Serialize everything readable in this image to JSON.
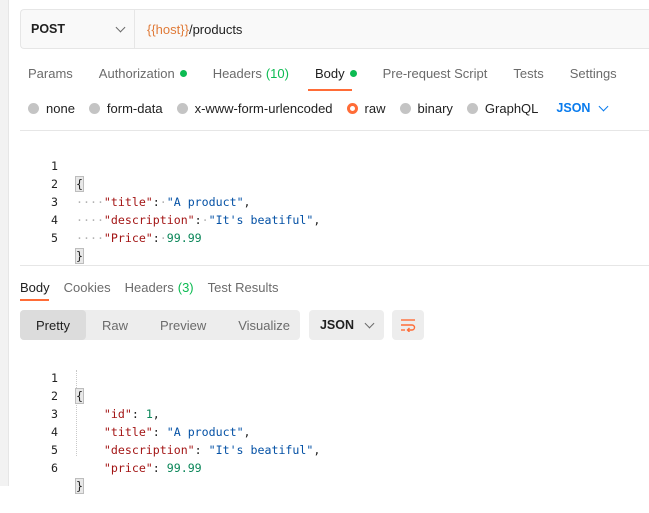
{
  "request": {
    "method": "POST",
    "url_var": "{{host}}",
    "url_path": "/products"
  },
  "request_tabs": [
    {
      "label": "Params"
    },
    {
      "label": "Authorization",
      "dot": true
    },
    {
      "label": "Headers",
      "count": "(10)"
    },
    {
      "label": "Body",
      "dot": true,
      "active": true
    },
    {
      "label": "Pre-request Script"
    },
    {
      "label": "Tests"
    },
    {
      "label": "Settings"
    }
  ],
  "body_types": {
    "options": [
      "none",
      "form-data",
      "x-www-form-urlencoded",
      "raw",
      "binary",
      "GraphQL"
    ],
    "selected": "raw",
    "format": "JSON"
  },
  "request_body": {
    "line_numbers": [
      "1",
      "2",
      "3",
      "4",
      "5"
    ],
    "open_brace": "{",
    "close_brace": "}",
    "fields": [
      {
        "key": "\"title\"",
        "value": "\"A product\"",
        "type": "str",
        "comma": ","
      },
      {
        "key": "\"description\"",
        "value": "\"It's beatiful\"",
        "type": "str",
        "comma": ","
      },
      {
        "key": "\"Price\"",
        "value": "99.99",
        "type": "num",
        "comma": ""
      }
    ]
  },
  "response_tabs": [
    {
      "label": "Body",
      "active": true
    },
    {
      "label": "Cookies"
    },
    {
      "label": "Headers",
      "count": "(3)"
    },
    {
      "label": "Test Results"
    }
  ],
  "response_view": {
    "modes": [
      "Pretty",
      "Raw",
      "Preview",
      "Visualize"
    ],
    "active_mode": "Pretty",
    "format": "JSON"
  },
  "response_body": {
    "line_numbers": [
      "1",
      "2",
      "3",
      "4",
      "5",
      "6"
    ],
    "open_brace": "{",
    "close_brace": "}",
    "fields": [
      {
        "key": "\"id\"",
        "value": "1",
        "type": "num",
        "comma": ","
      },
      {
        "key": "\"title\"",
        "value": "\"A product\"",
        "type": "str",
        "comma": ","
      },
      {
        "key": "\"description\"",
        "value": "\"It's beatiful\"",
        "type": "str",
        "comma": ","
      },
      {
        "key": "\"price\"",
        "value": "99.99",
        "type": "num",
        "comma": ""
      }
    ]
  },
  "colors": {
    "accent": "#ff6c37",
    "dot_green": "#0cbb52",
    "link_blue": "#097bed",
    "json_key": "#a31515",
    "json_string": "#0451a5",
    "json_number": "#098658"
  }
}
